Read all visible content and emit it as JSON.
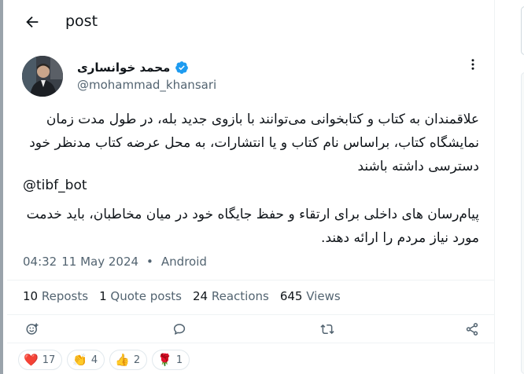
{
  "header": {
    "title": "post"
  },
  "author": {
    "name": "محمد خوانساری",
    "handle": "@mohammad_khansari",
    "verified": true
  },
  "post": {
    "paragraph1": "علاقمندان به کتاب و کتابخوانی می‌توانند با بازوی جدید بله، در طول مدت زمان نمایشگاه کتاب، براساس نام کتاب و یا انتشارات، به محل عرضه کتاب مدنظر خود دسترسی داشته باشند",
    "mention": "@tibf_bot",
    "paragraph2": "پیام‌رسان های داخلی برای ارتقاء و حفظ جایگاه خود در میان مخاطبان، باید خدمت مورد نیاز مردم را ارائه دهند."
  },
  "meta": {
    "time": "04:32",
    "date": "11 May 2024",
    "separator": "•",
    "client": "Android"
  },
  "stats": [
    {
      "count": "10",
      "label": "Reposts"
    },
    {
      "count": "1",
      "label": "Quote posts"
    },
    {
      "count": "24",
      "label": "Reactions"
    },
    {
      "count": "645",
      "label": "Views"
    }
  ],
  "reactions": [
    {
      "emoji": "❤️",
      "count": "17",
      "icon": "heart-icon"
    },
    {
      "emoji": "👏",
      "count": "4",
      "icon": "clap-icon"
    },
    {
      "emoji": "👍",
      "count": "2",
      "icon": "thumbs-up-icon"
    },
    {
      "emoji": "🌹",
      "count": "1",
      "icon": "rose-icon"
    }
  ],
  "colors": {
    "text": "#0f1419",
    "secondary": "#536471",
    "verified": "#1d9bf0",
    "divider": "#eff3f4"
  }
}
